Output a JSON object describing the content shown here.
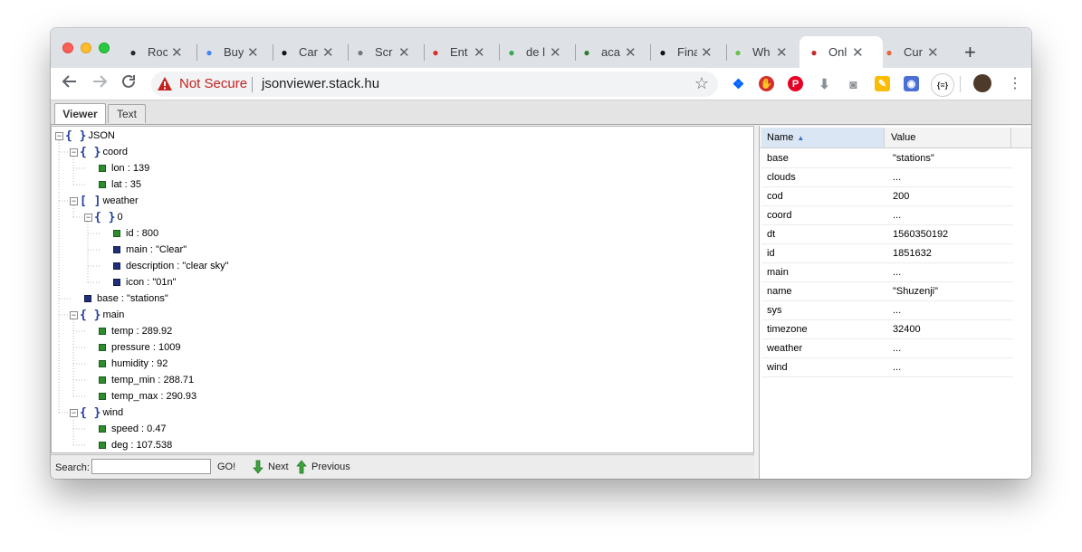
{
  "browser": {
    "tabs": [
      {
        "label": "Roc",
        "icon": "github-icon",
        "color": "#24292e"
      },
      {
        "label": "Buy",
        "icon": "chrome-web-store-icon",
        "color": "#4285f4"
      },
      {
        "label": "Car",
        "icon": "e-logo-icon",
        "color": "#111111"
      },
      {
        "label": "Scr",
        "icon": "camera-icon",
        "color": "#777777"
      },
      {
        "label": "Ent",
        "icon": "gmail-icon",
        "color": "#d93025"
      },
      {
        "label": "de l",
        "icon": "google-maps-icon",
        "color": "#34a853"
      },
      {
        "label": "aca",
        "icon": "package-icon",
        "color": "#2e7d32"
      },
      {
        "label": "Fina",
        "icon": "graduation-cap-icon",
        "color": "#111111"
      },
      {
        "label": "Wh",
        "icon": "wa3-icon",
        "color": "#6cc04a"
      },
      {
        "label": "Onl",
        "icon": "opera-icon",
        "color": "#c62828"
      },
      {
        "label": "Cur",
        "icon": "weather-icon",
        "color": "#e8643c"
      }
    ],
    "security_label": "Not Secure",
    "url": "jsonviewer.stack.hu",
    "json_extension_label": "{≡}"
  },
  "viewer": {
    "tabs": [
      "Viewer",
      "Text"
    ],
    "tree": [
      {
        "text": "JSON",
        "type": "object",
        "level": 0
      },
      {
        "text": "coord",
        "type": "object",
        "level": 1
      },
      {
        "text": "lon : 139",
        "type": "number",
        "level": 2
      },
      {
        "text": "lat : 35",
        "type": "number",
        "level": 2
      },
      {
        "text": "weather",
        "type": "array",
        "level": 1
      },
      {
        "text": "0",
        "type": "object",
        "level": 2
      },
      {
        "text": "id : 800",
        "type": "number",
        "level": 3
      },
      {
        "text": "main : \"Clear\"",
        "type": "string",
        "level": 3
      },
      {
        "text": "description : \"clear sky\"",
        "type": "string",
        "level": 3
      },
      {
        "text": "icon : \"01n\"",
        "type": "string",
        "level": 3
      },
      {
        "text": "base : \"stations\"",
        "type": "string",
        "level": 1
      },
      {
        "text": "main",
        "type": "object",
        "level": 1
      },
      {
        "text": "temp : 289.92",
        "type": "number",
        "level": 2
      },
      {
        "text": "pressure : 1009",
        "type": "number",
        "level": 2
      },
      {
        "text": "humidity : 92",
        "type": "number",
        "level": 2
      },
      {
        "text": "temp_min : 288.71",
        "type": "number",
        "level": 2
      },
      {
        "text": "temp_max : 290.93",
        "type": "number",
        "level": 2
      },
      {
        "text": "wind",
        "type": "object",
        "level": 1
      },
      {
        "text": "speed : 0.47",
        "type": "number",
        "level": 2
      },
      {
        "text": "deg : 107.538",
        "type": "number",
        "level": 2
      }
    ],
    "search": {
      "label": "Search:",
      "value": "",
      "go_label": "GO!",
      "next_label": "Next",
      "previous_label": "Previous"
    },
    "grid": {
      "headers": [
        "Name",
        "Value"
      ],
      "rows": [
        {
          "name": "base",
          "value": "\"stations\""
        },
        {
          "name": "clouds",
          "value": "..."
        },
        {
          "name": "cod",
          "value": "200"
        },
        {
          "name": "coord",
          "value": "..."
        },
        {
          "name": "dt",
          "value": "1560350192"
        },
        {
          "name": "id",
          "value": "1851632"
        },
        {
          "name": "main",
          "value": "..."
        },
        {
          "name": "name",
          "value": "\"Shuzenji\""
        },
        {
          "name": "sys",
          "value": "..."
        },
        {
          "name": "timezone",
          "value": "32400"
        },
        {
          "name": "weather",
          "value": "..."
        },
        {
          "name": "wind",
          "value": "..."
        }
      ]
    }
  },
  "colors": {
    "accent_red": "#c5221f",
    "number_leaf": "#2e8b2e",
    "string_leaf": "#1f2f7a",
    "brace": "#1f3b9a"
  }
}
